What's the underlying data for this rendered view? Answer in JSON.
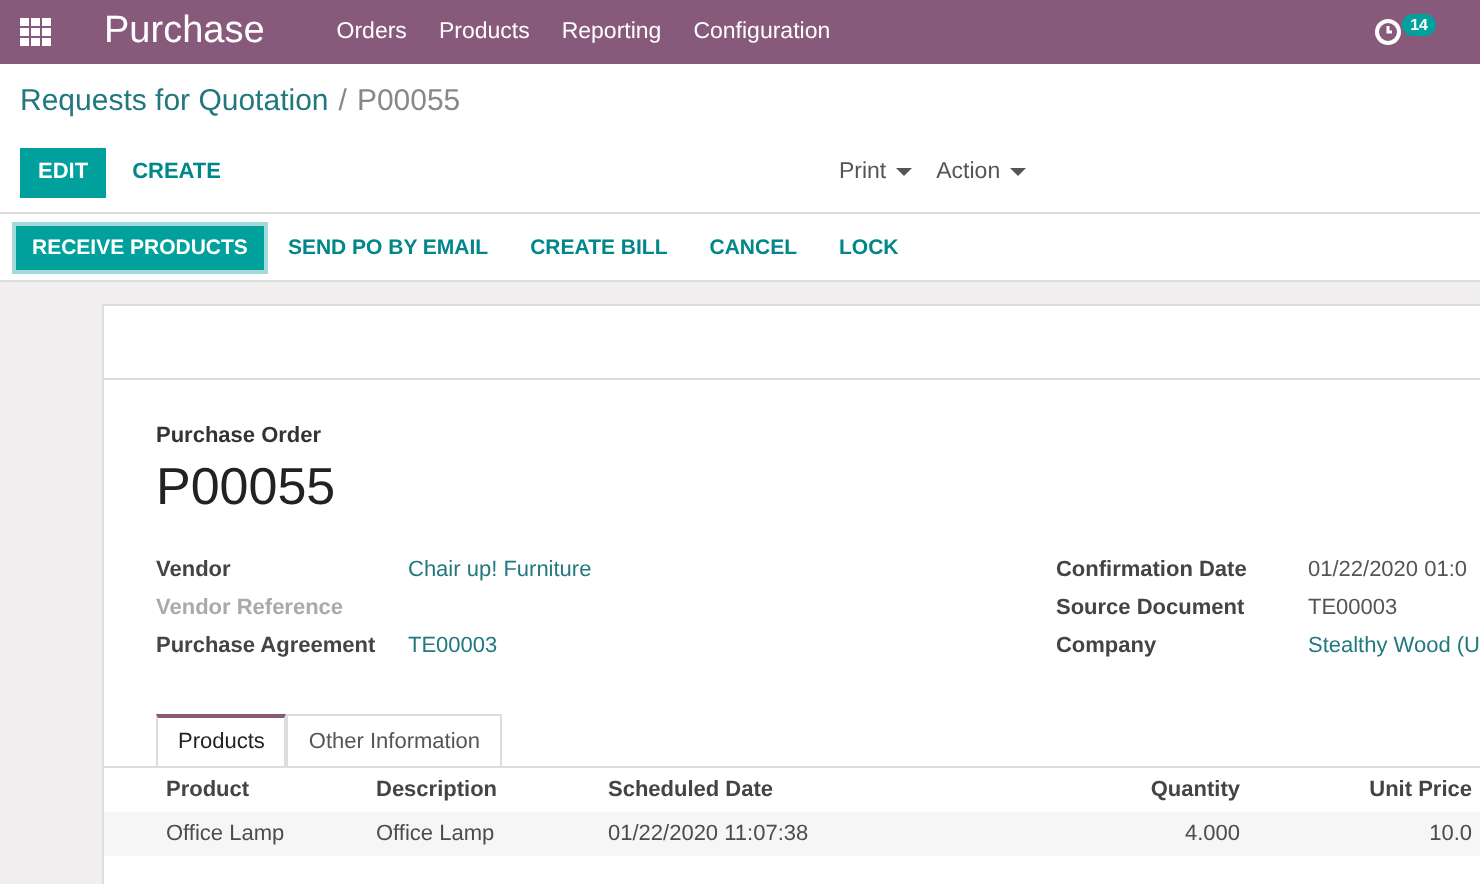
{
  "top_bar": {
    "app_title": "Purchase",
    "menu": [
      "Orders",
      "Products",
      "Reporting",
      "Configuration"
    ],
    "activity_count": "14"
  },
  "breadcrumb": {
    "parent": "Requests for Quotation",
    "separator": "/",
    "current": "P00055"
  },
  "control_buttons": [
    {
      "label": "EDIT",
      "kind": "primary"
    },
    {
      "label": "CREATE",
      "kind": "link"
    }
  ],
  "dropdowns": [
    "Print",
    "Action"
  ],
  "status_buttons": [
    {
      "label": "RECEIVE PRODUCTS",
      "kind": "primary"
    },
    {
      "label": "SEND PO BY EMAIL",
      "kind": "link"
    },
    {
      "label": "CREATE BILL",
      "kind": "link"
    },
    {
      "label": "CANCEL",
      "kind": "link"
    },
    {
      "label": "LOCK",
      "kind": "link"
    }
  ],
  "form": {
    "subtitle": "Purchase Order",
    "name": "P00055",
    "left_fields": [
      {
        "label": "Vendor",
        "value": "Chair up! Furniture",
        "kind": "link",
        "disabled": false
      },
      {
        "label": "Vendor Reference",
        "disabled": true
      },
      {
        "label": "Purchase Agreement",
        "value": "TE00003",
        "kind": "link",
        "disabled": false
      }
    ],
    "right_fields": [
      {
        "label": "Confirmation Date",
        "value": "01/22/2020 01:0",
        "kind": "text",
        "disabled": false
      },
      {
        "label": "Source Document",
        "value": "TE00003",
        "kind": "text",
        "disabled": false
      },
      {
        "label": "Company",
        "value": "Stealthy Wood (U",
        "kind": "link",
        "disabled": false
      }
    ],
    "tabs": [
      {
        "label": "Products",
        "selected": true
      },
      {
        "label": "Other Information",
        "selected": false
      }
    ],
    "table": {
      "columns": [
        "Product",
        "Description",
        "Scheduled Date",
        "Quantity",
        "Unit Price"
      ],
      "rows": [
        [
          "Office Lamp",
          "Office Lamp",
          "01/22/2020 11:07:38",
          "4.000",
          "10.0"
        ]
      ]
    }
  }
}
